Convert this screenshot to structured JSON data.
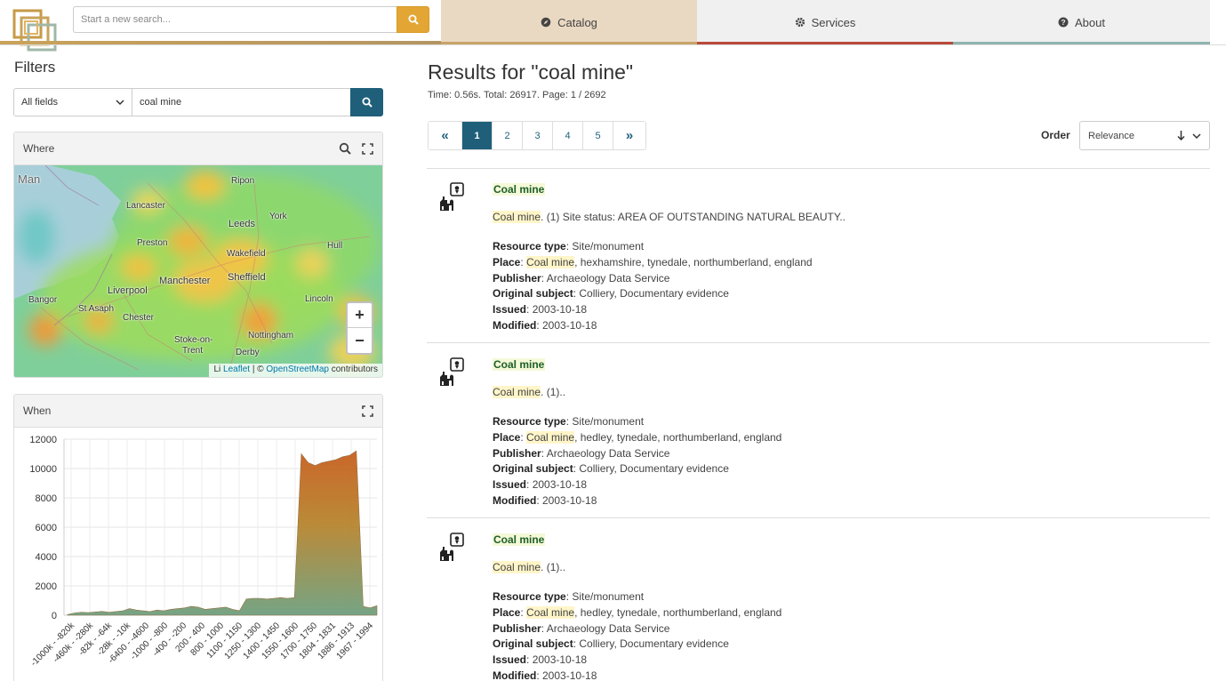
{
  "header": {
    "search_placeholder": "Start a new search...",
    "nav": [
      {
        "label": "Catalog",
        "icon": "compass-icon",
        "underline": "#c7a46a"
      },
      {
        "label": "Services",
        "icon": "gear-icon",
        "underline": "#b84a3a"
      },
      {
        "label": "About",
        "icon": "question-icon",
        "underline": "#8fb5b0"
      }
    ]
  },
  "filters": {
    "title": "Filters",
    "field_select": "All fields",
    "query": "coal mine",
    "where_title": "Where",
    "when_title": "When",
    "map_labels": [
      "Man",
      "Ripon",
      "Lancaster",
      "York",
      "Leeds",
      "Preston",
      "Wakefield",
      "Hull",
      "Manchester",
      "Sheffield",
      "Liverpool",
      "Lincoln",
      "Bangor",
      "St Asaph",
      "Chester",
      "Nottingham",
      "Stoke-on-",
      "Trent",
      "Derby"
    ],
    "attribution": {
      "prefix": "Li",
      "leaflet": "Leaflet",
      "sep": "| ©",
      "osm": "OpenStreetMap",
      "suffix": "contributors"
    },
    "zoom_in": "+",
    "zoom_out": "−"
  },
  "chart_data": {
    "type": "area",
    "title": "",
    "xlabel": "",
    "ylabel": "",
    "ylim": [
      0,
      12000
    ],
    "y_ticks": [
      0,
      2000,
      4000,
      6000,
      8000,
      10000,
      12000
    ],
    "grid": true,
    "categories": [
      "-1000k - -820k",
      "-460k - -280k",
      "-82k - -64k",
      "-28k - -10k",
      "-6400 - -4600",
      "-1000 - -800",
      "-400 - -200",
      "200 - 400",
      "800 - 1000",
      "1100 - 1150",
      "1250 - 1300",
      "1400 - 1450",
      "1550 - 1600",
      "1700 - 1750",
      "1804 - 1831",
      "1886 - 1913",
      "1967 - 1994"
    ],
    "series": [
      {
        "values": [
          50,
          150,
          200,
          180,
          220,
          260,
          200,
          250,
          300,
          450,
          350,
          300,
          250,
          350,
          300,
          400,
          450,
          500,
          600,
          550,
          400,
          450,
          500,
          550,
          400,
          300,
          1100,
          1150,
          1150,
          1100,
          1150,
          1200,
          1150,
          1200,
          11000,
          10400,
          10200,
          10400,
          10500,
          10600,
          10800,
          10900,
          11200,
          600,
          500,
          650
        ]
      }
    ]
  },
  "results": {
    "title": "Results for \"coal mine\"",
    "stats": "Time: 0.56s. Total: 26917. Page: 1 / 2692",
    "pagination": [
      "«",
      "1",
      "2",
      "3",
      "4",
      "5",
      "»"
    ],
    "order_label": "Order",
    "order_value": "Relevance",
    "items": [
      {
        "title": "Coal mine",
        "desc_hl": "Coal mine",
        "desc_rest": ". (1) Site status: AREA OF OUTSTANDING NATURAL BEAUTY..",
        "resource_type_label": "Resource type",
        "resource_type": "Site/monument",
        "place_label": "Place",
        "place_hl": "Coal mine",
        "place_rest": ", hexhamshire, tynedale, northumberland, england",
        "publisher_label": "Publisher",
        "publisher": "Archaeology Data Service",
        "subject_label": "Original subject",
        "subject": "Colliery, Documentary evidence",
        "issued_label": "Issued",
        "issued": "2003-10-18",
        "modified_label": "Modified",
        "modified": "2003-10-18"
      },
      {
        "title": "Coal mine",
        "desc_hl": "Coal mine",
        "desc_rest": ". (1)..",
        "resource_type_label": "Resource type",
        "resource_type": "Site/monument",
        "place_label": "Place",
        "place_hl": "Coal mine",
        "place_rest": ", hedley, tynedale, northumberland, england",
        "publisher_label": "Publisher",
        "publisher": "Archaeology Data Service",
        "subject_label": "Original subject",
        "subject": "Colliery, Documentary evidence",
        "issued_label": "Issued",
        "issued": "2003-10-18",
        "modified_label": "Modified",
        "modified": "2003-10-18"
      },
      {
        "title": "Coal mine",
        "desc_hl": "Coal mine",
        "desc_rest": ". (1)..",
        "resource_type_label": "Resource type",
        "resource_type": "Site/monument",
        "place_label": "Place",
        "place_hl": "Coal mine",
        "place_rest": ", hedley, tynedale, northumberland, england",
        "publisher_label": "Publisher",
        "publisher": "Archaeology Data Service",
        "subject_label": "Original subject",
        "subject": "Colliery, Documentary evidence",
        "issued_label": "Issued",
        "issued": "2003-10-18",
        "modified_label": "Modified",
        "modified": "2003-10-18"
      }
    ]
  },
  "colors": {
    "accent_gold": "#e3a634",
    "primary_teal": "#1f5f7a",
    "catalog_active": "#ead9c2"
  }
}
